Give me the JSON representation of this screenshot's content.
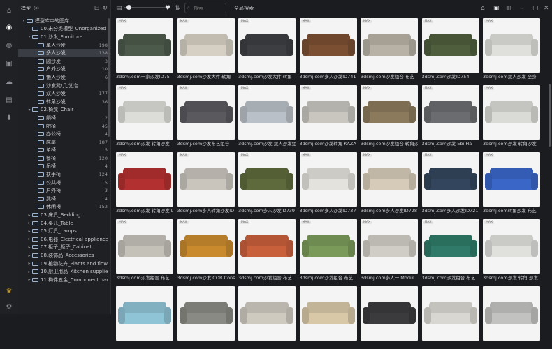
{
  "sidebar": {
    "title": "模型",
    "items": [
      {
        "label": "模型库中的图库",
        "depth": 0,
        "expand": "▾",
        "count": "",
        "sel": false
      },
      {
        "label": "00.未分类模型_Unorganized",
        "depth": 1,
        "expand": "",
        "count": "",
        "sel": false
      },
      {
        "label": "01.沙发_Furniture",
        "depth": 1,
        "expand": "▾",
        "count": "",
        "sel": false
      },
      {
        "label": "单人沙发",
        "depth": 2,
        "expand": "",
        "count": "198",
        "sel": false
      },
      {
        "label": "多人沙发",
        "depth": 2,
        "expand": "",
        "count": "138",
        "sel": true
      },
      {
        "label": "圆沙发",
        "depth": 2,
        "expand": "",
        "count": "3",
        "sel": false
      },
      {
        "label": "户外沙发",
        "depth": 2,
        "expand": "",
        "count": "10",
        "sel": false
      },
      {
        "label": "懒人沙发",
        "depth": 2,
        "expand": "",
        "count": "6",
        "sel": false
      },
      {
        "label": "沙发凳/几/边台",
        "depth": 2,
        "expand": "",
        "count": "",
        "sel": false
      },
      {
        "label": "双人沙发",
        "depth": 2,
        "expand": "",
        "count": "177",
        "sel": false
      },
      {
        "label": "转角沙发",
        "depth": 2,
        "expand": "",
        "count": "36",
        "sel": false
      },
      {
        "label": "02.椅凳_Chair",
        "depth": 1,
        "expand": "▾",
        "count": "",
        "sel": false
      },
      {
        "label": "躺椅",
        "depth": 2,
        "expand": "",
        "count": "2",
        "sel": false
      },
      {
        "label": "吧椅",
        "depth": 2,
        "expand": "",
        "count": "45",
        "sel": false
      },
      {
        "label": "办公椅",
        "depth": 2,
        "expand": "",
        "count": "4",
        "sel": false
      },
      {
        "label": "床尾",
        "depth": 2,
        "expand": "",
        "count": "187",
        "sel": false
      },
      {
        "label": "单椅",
        "depth": 2,
        "expand": "",
        "count": "5",
        "sel": false
      },
      {
        "label": "餐椅",
        "depth": 2,
        "expand": "",
        "count": "120",
        "sel": false
      },
      {
        "label": "吊椅",
        "depth": 2,
        "expand": "",
        "count": "4",
        "sel": false
      },
      {
        "label": "扶手椅",
        "depth": 2,
        "expand": "",
        "count": "124",
        "sel": false
      },
      {
        "label": "公共椅",
        "depth": 2,
        "expand": "",
        "count": "5",
        "sel": false
      },
      {
        "label": "户外椅",
        "depth": 2,
        "expand": "",
        "count": "3",
        "sel": false
      },
      {
        "label": "凳椅",
        "depth": 2,
        "expand": "",
        "count": "4",
        "sel": false
      },
      {
        "label": "休闲椅",
        "depth": 2,
        "expand": "",
        "count": "152",
        "sel": false
      },
      {
        "label": "03.床具_Bedding",
        "depth": 1,
        "expand": "▸",
        "count": "",
        "sel": false
      },
      {
        "label": "04.桌几_Table",
        "depth": 1,
        "expand": "▸",
        "count": "",
        "sel": false
      },
      {
        "label": "05.灯具_Lamps",
        "depth": 1,
        "expand": "▸",
        "count": "",
        "sel": false
      },
      {
        "label": "06.电器_Electrical appliance",
        "depth": 1,
        "expand": "▸",
        "count": "",
        "sel": false
      },
      {
        "label": "07.柜子_柜子_Cabinet",
        "depth": 1,
        "expand": "▸",
        "count": "",
        "sel": false
      },
      {
        "label": "08.装饰品_Accessories",
        "depth": 1,
        "expand": "▸",
        "count": "",
        "sel": false
      },
      {
        "label": "09.植物花卉_Plants and flowers",
        "depth": 1,
        "expand": "▸",
        "count": "",
        "sel": false
      },
      {
        "label": "10.厨卫用品_Kitchen supplies",
        "depth": 1,
        "expand": "▸",
        "count": "",
        "sel": false
      },
      {
        "label": "11.构件五金_Component hardware",
        "depth": 1,
        "expand": "▸",
        "count": "",
        "sel": false
      }
    ]
  },
  "toolbar": {
    "search_placeholder": "搜索",
    "scope_label": "全局搜索"
  },
  "cards": [
    {
      "caption": "3dsmj.com一家沙发ID75",
      "tag": "MAX",
      "color": "#4b5a4a"
    },
    {
      "caption": "3dsmj.com沙发大件 转角",
      "tag": "MAX",
      "color": "#d6d0c4"
    },
    {
      "caption": "3dsmj.com沙发大件 转角",
      "tag": "MAX",
      "color": "#3c3e42"
    },
    {
      "caption": "3dsmj.com多人沙发ID741",
      "tag": "MAX",
      "color": "#7a4f32"
    },
    {
      "caption": "3dsmj.com沙发组合 布艺",
      "tag": "MAX",
      "color": "#b8b2a6"
    },
    {
      "caption": "3dsmj.com沙发ID754",
      "tag": "MAX",
      "color": "#4f5e3c"
    },
    {
      "caption": "3dsmj.com双人沙发 全身",
      "tag": "MAX",
      "color": "#dfe0dc"
    },
    {
      "caption": "3dsmj.com沙发 转角沙发",
      "tag": "MAX",
      "color": "#dcdcd8"
    },
    {
      "caption": "3dsmj.com沙发布艺组合",
      "tag": "MAX",
      "color": "#5a5a5e"
    },
    {
      "caption": "3dsmj.com沙发 双人沙发组合",
      "tag": "MAX",
      "color": "#b9c0c7"
    },
    {
      "caption": "3dsmj.com沙发转角 KAZA",
      "tag": "MAX",
      "color": "#c8c6bf"
    },
    {
      "caption": "3dsmj.com沙发组合 转角沙发",
      "tag": "MAX",
      "color": "#8b7a5c"
    },
    {
      "caption": "3dsmj.com沙发 Ebi Ha",
      "tag": "MAX",
      "color": "#6a6c6f"
    },
    {
      "caption": "3dsmj.com沙发 转角沙发",
      "tag": "MAX",
      "color": "#dadad6"
    },
    {
      "caption": "3dsmj.com沙发 转角沙发ID752",
      "tag": "MAX",
      "color": "#b33030"
    },
    {
      "caption": "3dsmj.com多人转角沙发ID733",
      "tag": "MAX",
      "color": "#c9c5bd"
    },
    {
      "caption": "3dsmj.com多人沙发ID739",
      "tag": "MAX",
      "color": "#5e6a3c"
    },
    {
      "caption": "3dsmj.com多人沙发ID737",
      "tag": "MAX",
      "color": "#e4e2dc"
    },
    {
      "caption": "3dsmj.com多人沙发ID728",
      "tag": "MAX",
      "color": "#d6cbb8"
    },
    {
      "caption": "3dsmj.com多人沙发ID721",
      "tag": "MAX",
      "color": "#33455c"
    },
    {
      "caption": "3dsmj.com转角沙发 布艺",
      "tag": "MAX",
      "color": "#3a66c8"
    },
    {
      "caption": "3dsmj.com沙发组合 布艺",
      "tag": "MAX",
      "color": "#c4c1b9"
    },
    {
      "caption": "3dsmj.com沙发 COR Cons",
      "tag": "MAX",
      "color": "#c98a2e"
    },
    {
      "caption": "3dsmj.com沙发组合 布艺",
      "tag": "MAX",
      "color": "#c8603c"
    },
    {
      "caption": "3dsmj.com沙发组合 布艺",
      "tag": "MAX",
      "color": "#7a9a5a"
    },
    {
      "caption": "3dsmj.com多人一 Modul",
      "tag": "MAX",
      "color": "#d0cdc6"
    },
    {
      "caption": "3dsmj.com沙发组合 布艺",
      "tag": "MAX",
      "color": "#2f7a68"
    },
    {
      "caption": "3dsmj.com沙发 转角 沙发",
      "tag": "MAX",
      "color": "#e0e0dd"
    },
    {
      "caption": "",
      "tag": "",
      "color": "#8fc3d6"
    },
    {
      "caption": "",
      "tag": "",
      "color": "#8a8a84"
    },
    {
      "caption": "",
      "tag": "",
      "color": "#cfcac0"
    },
    {
      "caption": "",
      "tag": "",
      "color": "#d8c8a8"
    },
    {
      "caption": "",
      "tag": "",
      "color": "#3b3b3e"
    },
    {
      "caption": "",
      "tag": "",
      "color": "#d9d7d1"
    },
    {
      "caption": "",
      "tag": "",
      "color": "#c2c3c1"
    }
  ]
}
